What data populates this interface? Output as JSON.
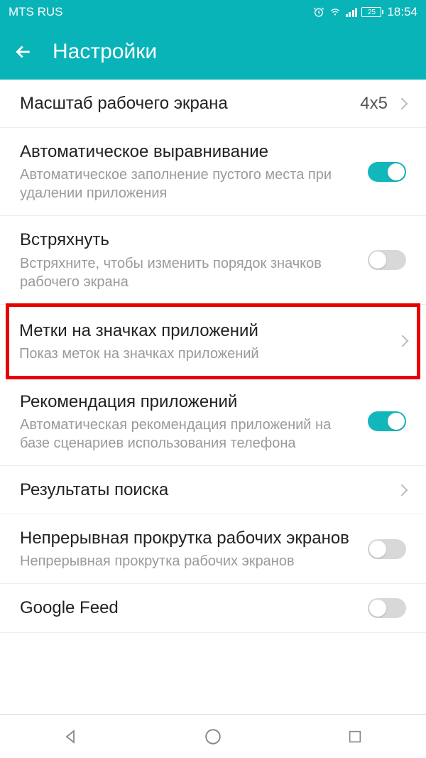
{
  "status": {
    "carrier": "MTS RUS",
    "battery": "25",
    "time": "18:54"
  },
  "header": {
    "title": "Настройки"
  },
  "rows": {
    "grid": {
      "title": "Масштаб рабочего экрана",
      "value": "4x5"
    },
    "autoalign": {
      "title": "Автоматическое выравнивание",
      "sub": "Автоматическое заполнение пустого места при удалении приложения"
    },
    "shake": {
      "title": "Встряхнуть",
      "sub": "Встряхните, чтобы изменить порядок значков рабочего экрана"
    },
    "badges": {
      "title": "Метки на значках приложений",
      "sub": "Показ меток на значках приложений"
    },
    "recommend": {
      "title": "Рекомендация приложений",
      "sub": "Автоматическая рекомендация приложений на базе сценариев использования телефона"
    },
    "search": {
      "title": "Результаты поиска"
    },
    "loop": {
      "title": "Непрерывная прокрутка рабочих экранов",
      "sub": "Непрерывная прокрутка рабочих экранов"
    },
    "googlefeed": {
      "title": "Google Feed"
    }
  }
}
